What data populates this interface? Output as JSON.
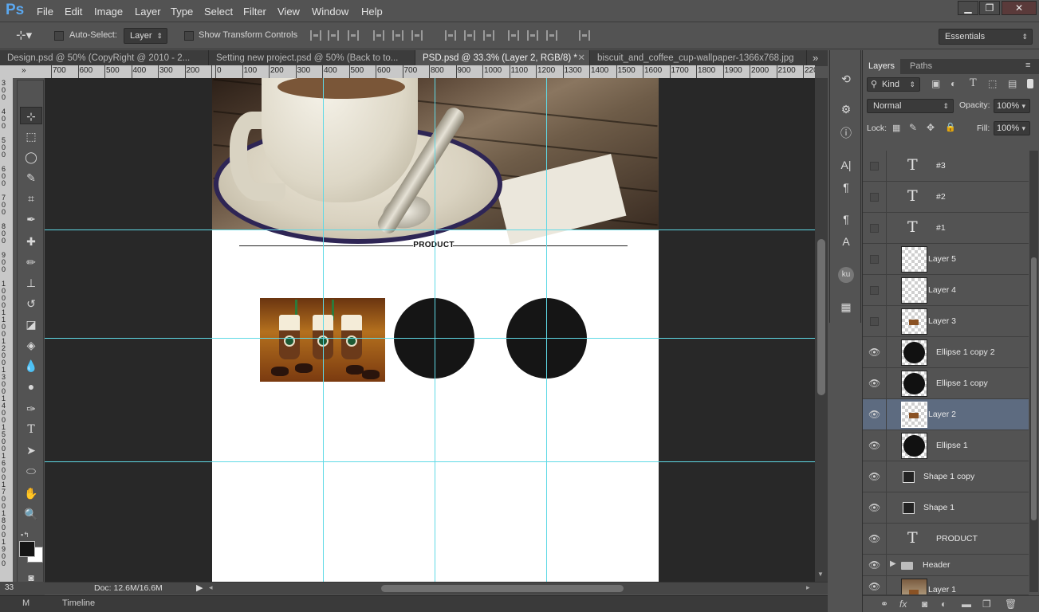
{
  "app": {
    "logo": "Ps"
  },
  "menu": [
    "File",
    "Edit",
    "Image",
    "Layer",
    "Type",
    "Select",
    "Filter",
    "View",
    "Window",
    "Help"
  ],
  "window_controls": {
    "minimize": "▁",
    "maximize": "❐",
    "close": "✕"
  },
  "options_bar": {
    "auto_select_label": "Auto-Select:",
    "auto_select_value": "Layer",
    "show_transform_label": "Show Transform Controls",
    "workspace": "Essentials"
  },
  "doc_tabs": [
    {
      "label": "Design.psd @ 50% (CopyRight @ 2010 - 2..."
    },
    {
      "label": "Setting new project.psd @ 50% (Back to to..."
    },
    {
      "label": "PSD.psd @ 33.3% (Layer 2, RGB/8) *"
    },
    {
      "label": "biscuit_and_coffee_cup-wallpaper-1366x768.jpg"
    }
  ],
  "tab_overflow": "»",
  "ruler_h": {
    "left_labels": [
      "700",
      "600",
      "500",
      "400",
      "300",
      "200",
      "100"
    ],
    "labels": [
      "0",
      "100",
      "200",
      "300",
      "400",
      "500",
      "600",
      "700",
      "800",
      "900",
      "1000",
      "1100",
      "1200",
      "1300",
      "1400",
      "1500",
      "1600",
      "1700",
      "1800",
      "1900",
      "2000",
      "2100",
      "2200"
    ]
  },
  "ruler_v": {
    "labels": [
      "3 0 0",
      "4 0 0",
      "5 0 0",
      "6 0 0",
      "7 0 0",
      "8 0 0",
      "9 0 0",
      "1 0 0 0",
      "1 1 0 0",
      "1 2 0 0",
      "1 3 0 0",
      "1 4 0 0",
      "1 5 0 0",
      "1 6 0 0",
      "1 7 0 0",
      "1 8 0 0",
      "1 9 0 0"
    ]
  },
  "canvas": {
    "product_title": "PRODUCT"
  },
  "status": {
    "zoom": "33",
    "doc_size": "Doc: 12.6M/16.6M"
  },
  "bottom_tabs": {
    "mini_bridge": "M",
    "timeline": "Timeline"
  },
  "panel": {
    "tabs": [
      "Layers",
      "Paths"
    ],
    "filter_kind": "Kind",
    "blend_mode": "Normal",
    "opacity_label": "Opacity:",
    "opacity_value": "100%",
    "lock_label": "Lock:",
    "fill_label": "Fill:",
    "fill_value": "100%"
  },
  "layers": [
    {
      "name": "#3",
      "kind": "text",
      "visible": false
    },
    {
      "name": "#2",
      "kind": "text",
      "visible": false
    },
    {
      "name": "#1",
      "kind": "text",
      "visible": false
    },
    {
      "name": "Layer 5",
      "kind": "pixel",
      "visible": false
    },
    {
      "name": "Layer 4",
      "kind": "pixel",
      "visible": false
    },
    {
      "name": "Layer 3",
      "kind": "image",
      "visible": false
    },
    {
      "name": "Ellipse 1 copy 2",
      "kind": "ellipse",
      "visible": true
    },
    {
      "name": "Ellipse 1 copy",
      "kind": "ellipse",
      "visible": true
    },
    {
      "name": "Layer 2",
      "kind": "image",
      "visible": true,
      "selected": true
    },
    {
      "name": "Ellipse 1",
      "kind": "ellipse",
      "visible": true
    },
    {
      "name": "Shape 1 copy",
      "kind": "shape",
      "visible": true
    },
    {
      "name": "Shape 1",
      "kind": "shape",
      "visible": true
    },
    {
      "name": "PRODUCT",
      "kind": "text",
      "visible": true
    },
    {
      "name": "Header",
      "kind": "group",
      "visible": true
    },
    {
      "name": "Layer 1",
      "kind": "image",
      "visible": true
    }
  ],
  "colors": {
    "guide": "#5fd9e6",
    "selected_layer": "#5d6b80",
    "ellipse_fill": "#151515",
    "ps_blue": "#5ba8f0"
  }
}
